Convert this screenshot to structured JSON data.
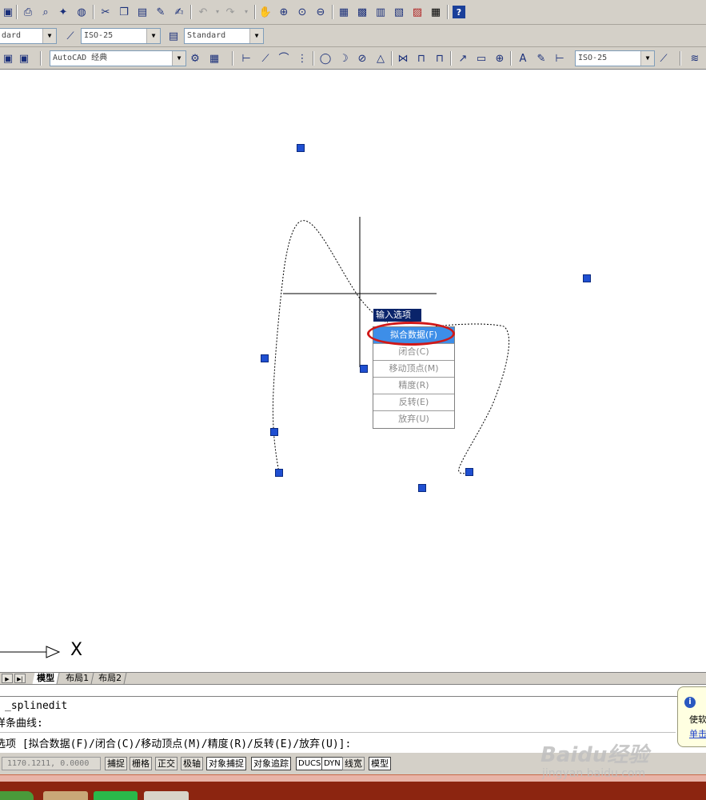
{
  "toolbar": {
    "text_style_value": "dard",
    "dim_style_value": "ISO-25",
    "table_style_value": "Standard",
    "workspace_value": "AutoCAD 经典",
    "dim_style_value_2": "ISO-25"
  },
  "canvas": {
    "ucs_x_label": "X"
  },
  "context_menu": {
    "title": "输入选项",
    "items": [
      {
        "label": "拟合数据(F)",
        "selected": true
      },
      {
        "label": "闭合(C)"
      },
      {
        "label": "移动顶点(M)"
      },
      {
        "label": "精度(R)"
      },
      {
        "label": "反转(E)"
      },
      {
        "label": "放弃(U)"
      }
    ]
  },
  "layout_tabs": [
    "模型",
    "布局1",
    "布局2"
  ],
  "command_line": {
    "line1": "_splinedit",
    "line2": "样条曲线:",
    "line3": "选项 [拟合数据(F)/闭合(C)/移动顶点(M)/精度(R)/反转(E)/放弃(U)]:"
  },
  "status_bar": {
    "coordinates": "1170.1211, 0.0000",
    "buttons": [
      "捕捉",
      "栅格",
      "正交",
      "极轴",
      "对象捕捉",
      "对象追踪",
      "DUCS",
      "DYN",
      "线宽",
      "模型"
    ]
  },
  "notification": {
    "text": "使软",
    "link": "单击"
  },
  "watermark": {
    "logo": "Baidu经验",
    "url": "jingyan.baidu.com"
  },
  "colors": {
    "grip": "#1f4fd1",
    "highlight_ring": "#d01818",
    "menu_selected": "#3d8ee8",
    "menu_title": "#0a246a",
    "taskbar": "#8c2510"
  }
}
